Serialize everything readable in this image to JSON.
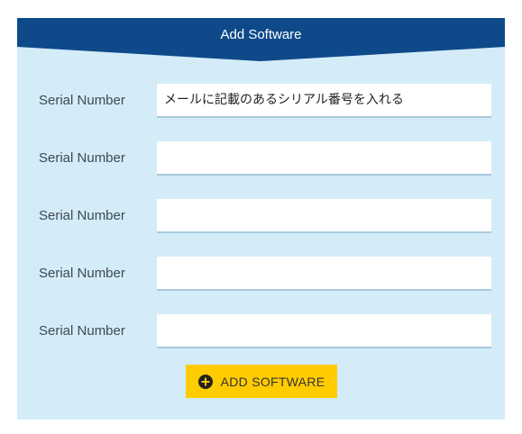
{
  "header": {
    "title": "Add Software"
  },
  "colors": {
    "header": "#0e4a8a",
    "panel": "#d4ebf8",
    "button": "#ffcc00"
  },
  "rows": [
    {
      "label": "Serial Number",
      "value": "",
      "placeholder": "メールに記載のあるシリアル番号を入れる"
    },
    {
      "label": "Serial Number",
      "value": "",
      "placeholder": ""
    },
    {
      "label": "Serial Number",
      "value": "",
      "placeholder": ""
    },
    {
      "label": "Serial Number",
      "value": "",
      "placeholder": ""
    },
    {
      "label": "Serial Number",
      "value": "",
      "placeholder": ""
    }
  ],
  "button": {
    "label": "ADD SOFTWARE",
    "icon": "plus-circle-icon"
  }
}
